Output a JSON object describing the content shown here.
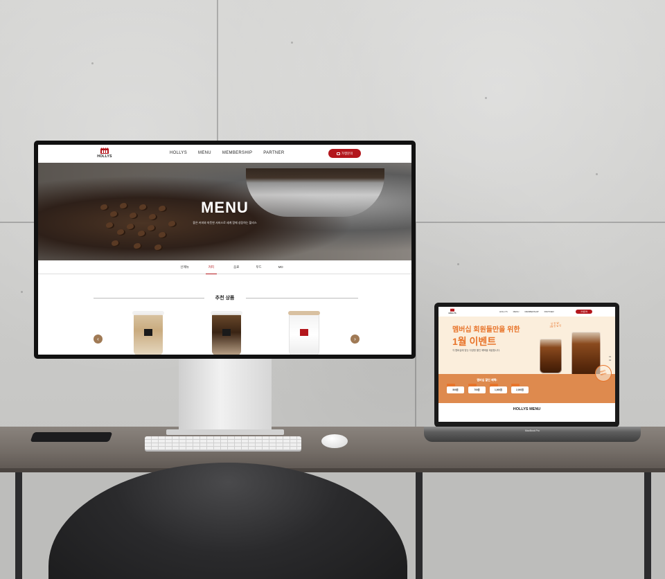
{
  "monitor_site": {
    "logo_text": "HOLLYS",
    "nav": [
      "HOLLYS",
      "MENU",
      "MEMBERSHIP",
      "PARTNER"
    ],
    "pill_label": "가맹문의",
    "hero_title": "MENU",
    "hero_subtitle": "좋은 커피와 따뜻한 서비스로 세계 함께 성장하는 할리스",
    "tabs": [
      "신메뉴",
      "커피",
      "음료",
      "푸드",
      "MD"
    ],
    "active_tab": "커피",
    "recommended_title": "추천 상품",
    "prev_icon": "arrow-left-icon",
    "next_icon": "arrow-right-icon"
  },
  "laptop_site": {
    "logo_text": "HOLLYS",
    "nav": [
      "HOLLYS",
      "MENU",
      "MEMBERSHIP",
      "PARTNER"
    ],
    "pill_label": "가맹문의",
    "event_title_line1": "멤버십 회원들만을 위한",
    "event_title_line2": "1월 이벤트",
    "event_desc": "각 멤버십에 맞는 다양한 할인 혜택을 제공합니다.",
    "handwritten_note_line1": "단 한 달!",
    "handwritten_note_line2": "1월 한 달 만",
    "stamp_text_line1": "BEST",
    "stamp_text_line2": "MENU",
    "side_label_line1": "01",
    "side_label_line2": "02",
    "band_title": "멤버십 할인 혜택!",
    "chips": [
      "500원",
      "700원",
      "1,000원",
      "2,000원"
    ],
    "menu_title": "HOLLYS MENU",
    "model_label": "MacBook Pro"
  },
  "colors": {
    "brand_red": "#b3161c",
    "event_orange": "#e8742a",
    "band_orange": "#de8a4e",
    "arrow_brown": "#a07a55"
  }
}
